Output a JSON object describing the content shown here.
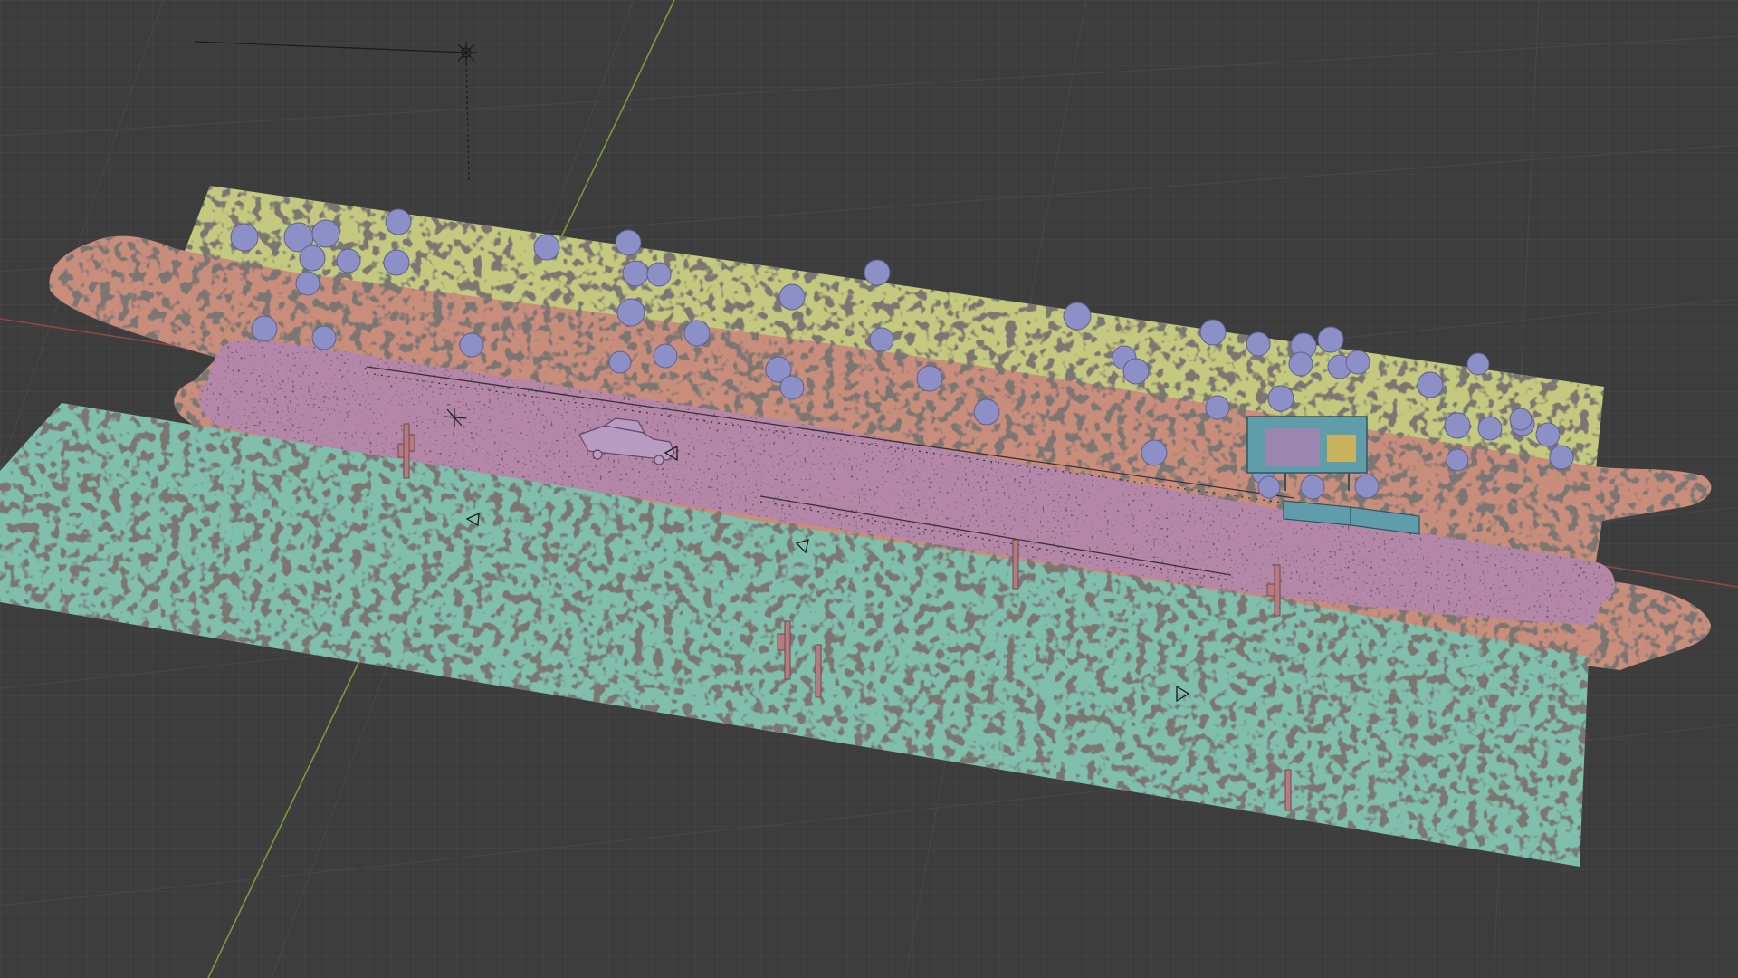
{
  "viewport": {
    "background": "#3d3d3d",
    "grid_color": "#4a4a4a",
    "x_axis_color": "#b34a4a",
    "y_axis_color": "#8db33a"
  },
  "scene": {
    "objects": [
      {
        "name": "terrain-back-strip",
        "color": "#c3c97e"
      },
      {
        "name": "terrain-berm-strip",
        "color": "#c98d7c"
      },
      {
        "name": "road-surface",
        "color": "#b487a8"
      },
      {
        "name": "terrain-front-strip",
        "color": "#7fbfac"
      }
    ],
    "shrub_color": "#8c90c6",
    "vegetation_color": "#332e2c",
    "cactus_color": "#b57b80",
    "car_color": "#b79bc1",
    "billboard": {
      "frame_color": "#5f9dab",
      "panel_color": "#9b86b0",
      "accent_color": "#c9b25d"
    },
    "selected_outline": "#e5a33a",
    "icons": [
      "light-icon",
      "camera-icon",
      "empty-icon"
    ]
  }
}
